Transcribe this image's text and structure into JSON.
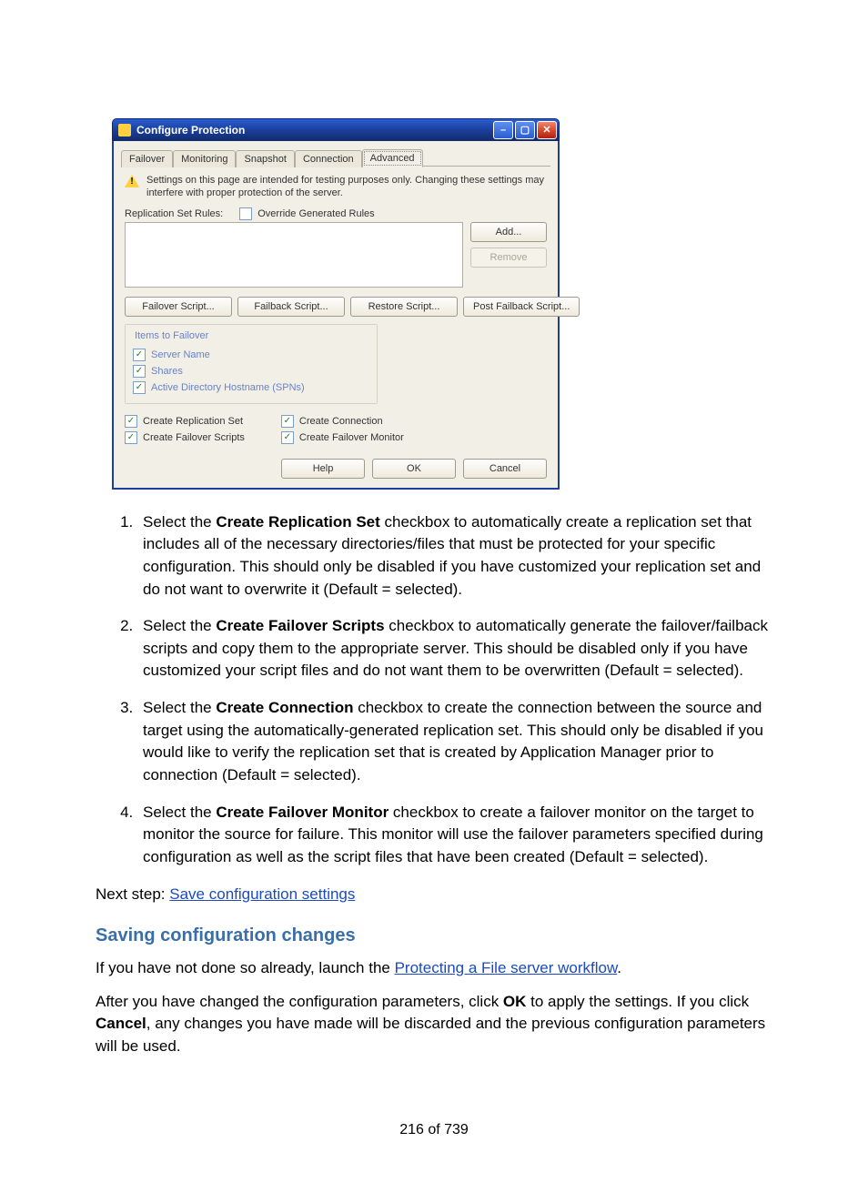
{
  "window": {
    "title": "Configure Protection",
    "tabs": [
      "Failover",
      "Monitoring",
      "Snapshot",
      "Connection",
      "Advanced"
    ],
    "active_tab": 4,
    "notice": "Settings on this page are intended for testing purposes only. Changing these settings may interfere with proper protection of the server.",
    "replication_label": "Replication Set Rules:",
    "override_label": "Override Generated Rules",
    "add_btn": "Add...",
    "remove_btn": "Remove",
    "script_buttons": [
      "Failover Script...",
      "Failback Script...",
      "Restore Script...",
      "Post Failback Script..."
    ],
    "items_group_title": "Items to Failover",
    "items": [
      "Server Name",
      "Shares",
      "Active Directory Hostname (SPNs)"
    ],
    "opts_left": [
      "Create Replication Set",
      "Create Failover Scripts"
    ],
    "opts_right": [
      "Create Connection",
      "Create Failover Monitor"
    ],
    "help_btn": "Help",
    "ok_btn": "OK",
    "cancel_btn": "Cancel"
  },
  "doc": {
    "li1_a": "Select the ",
    "li1_b": "Create Replication Set",
    "li1_c": " checkbox to automatically create a replication set that includes all of the necessary directories/files that must be protected for your specific configuration. This should only be disabled if you have customized your replication set and do not want to overwrite it (Default = selected).",
    "li2_a": "Select the ",
    "li2_b": "Create Failover Scripts",
    "li2_c": " checkbox to automatically generate the failover/failback scripts and copy them to the appropriate server. This should be disabled only if you have customized your script files and do not want them to be overwritten (Default = selected).",
    "li3_a": "Select the ",
    "li3_b": "Create Connection",
    "li3_c": " checkbox to create the connection between the source and target using the automatically-generated replication set. This should only be disabled if you would like to verify the replication set that is created by Application Manager prior to connection (Default = selected).",
    "li4_a": "Select the ",
    "li4_b": "Create Failover Monitor",
    "li4_c": " checkbox to create a failover monitor on the target to monitor the source for failure. This monitor will use the failover parameters specified during configuration as well as the script files that have been created (Default = selected).",
    "nextstep_a": "Next step: ",
    "nextstep_link": "Save configuration settings",
    "heading": "Saving configuration changes",
    "p1_a": "If you have not done so already, launch the ",
    "p1_link": "Protecting a File server workflow",
    "p1_b": ".",
    "p2_a": "After you have changed the configuration parameters, click ",
    "p2_b": "OK",
    "p2_c": " to apply the settings. If you click ",
    "p2_d": "Cancel",
    "p2_e": ", any changes you have made will be discarded and the previous configuration parameters will be used.",
    "pagenum": "216 of 739"
  }
}
